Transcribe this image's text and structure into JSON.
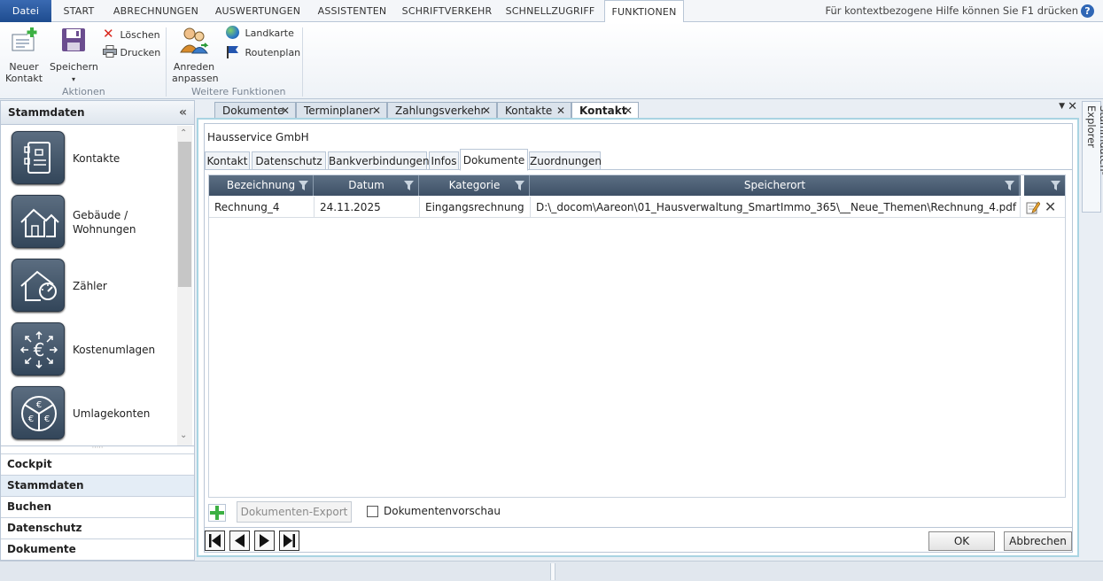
{
  "ribbon": {
    "tabs": [
      "Datei",
      "START",
      "ABRECHNUNGEN",
      "AUSWERTUNGEN",
      "ASSISTENTEN",
      "SCHRIFTVERKEHR",
      "SCHNELLZUGRIFF",
      "FUNKTIONEN"
    ],
    "active_tab": "FUNKTIONEN",
    "help_hint": "Für kontextbezogene Hilfe können Sie F1 drücken",
    "help_icon": "?",
    "groups": {
      "actions": {
        "label": "Aktionen",
        "new_contact": [
          "Neuer",
          "Kontakt"
        ],
        "save": "Speichern",
        "delete": "Löschen",
        "print": "Drucken"
      },
      "more": {
        "label": "Weitere Funktionen",
        "salutation": [
          "Anreden",
          "anpassen"
        ],
        "map": "Landkarte",
        "route": "Routenplan"
      }
    }
  },
  "left_panel": {
    "title": "Stammdaten",
    "collapse": "«",
    "nav_items": [
      {
        "label": "Kontakte",
        "icon": "contacts-icon"
      },
      {
        "label": "Gebäude /",
        "label2": "Wohnungen",
        "icon": "building-icon"
      },
      {
        "label": "Zähler",
        "icon": "meter-icon"
      },
      {
        "label": "Kostenumlagen",
        "icon": "euro-arrows-icon"
      },
      {
        "label": "Umlagekonten",
        "icon": "euro-pie-icon"
      }
    ],
    "sections": [
      "Cockpit",
      "Stammdaten",
      "Buchen",
      "Datenschutz",
      "Dokumente"
    ],
    "active_section": "Stammdaten"
  },
  "doc_tabs": {
    "tabs": [
      "Dokumente",
      "Terminplaner",
      "Zahlungsverkehr",
      "Kontakte",
      "Kontakt"
    ],
    "active": "Kontakt",
    "close": "✕"
  },
  "form": {
    "company": "Hausservice GmbH",
    "sub_tabs": [
      "Kontakt",
      "Datenschutz",
      "Bankverbindungen",
      "Infos",
      "Dokumente",
      "Zuordnungen"
    ],
    "active_sub_tab": "Dokumente",
    "grid": {
      "columns": [
        "Bezeichnung",
        "Datum",
        "Kategorie",
        "Speicherort"
      ],
      "rows": [
        [
          "Rechnung_4",
          "24.11.2025",
          "Eingangsrechnung",
          "D:\\_docom\\Aareon\\01_Hausverwaltung_SmartImmo_365\\__Neue_Themen\\Rechnung_4.pdf"
        ]
      ]
    },
    "export_button": "Dokumenten-Export",
    "preview_label": "Dokumentenvorschau",
    "ok_button": "OK",
    "cancel_button": "Abbrechen"
  },
  "explorer": {
    "label": "Stammdaten-Explorer"
  },
  "colors": {
    "accent": "#2b579a",
    "header": "#4a5c70",
    "frame": "#a9d4e2"
  }
}
